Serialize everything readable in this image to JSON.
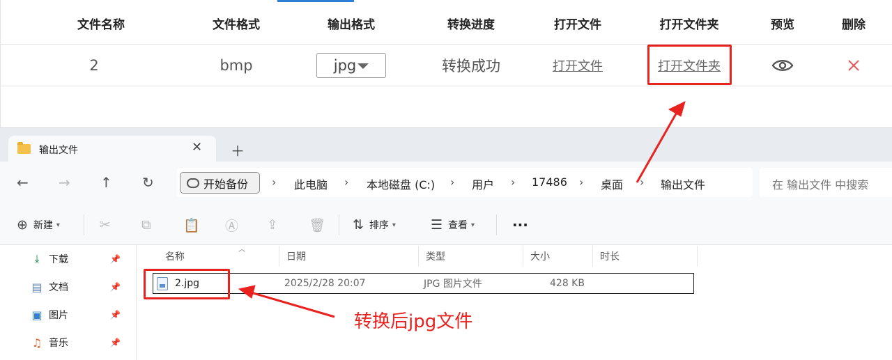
{
  "converter": {
    "headers": [
      "文件名称",
      "文件格式",
      "输出格式",
      "转换进度",
      "打开文件",
      "打开文件夹",
      "预览",
      "删除"
    ],
    "row": {
      "name": "2",
      "format": "bmp",
      "output_format": "jpg",
      "status": "转换成功",
      "open_file": "打开文件",
      "open_folder": "打开文件夹"
    }
  },
  "annotation": {
    "label": "转换后jpg文件",
    "color": "#e8221f"
  },
  "explorer": {
    "tab_title": "输出文件",
    "backup_label": "开始备份",
    "breadcrumbs": [
      "此电脑",
      "本地磁盘 (C:)",
      "用户",
      "17486",
      "桌面",
      "输出文件"
    ],
    "search_placeholder": "在 输出文件 中搜索",
    "commands": {
      "new": "新建",
      "sort": "排序",
      "view": "查看"
    },
    "sidebar": [
      {
        "label": "下载",
        "icon": "download-icon"
      },
      {
        "label": "文档",
        "icon": "document-icon"
      },
      {
        "label": "图片",
        "icon": "picture-icon"
      },
      {
        "label": "音乐",
        "icon": "music-icon"
      }
    ],
    "columns": [
      "名称",
      "日期",
      "类型",
      "大小",
      "时长"
    ],
    "files": [
      {
        "name": "2.jpg",
        "date": "2025/2/28 20:07",
        "type": "JPG 图片文件",
        "size": "428 KB",
        "duration": ""
      }
    ]
  }
}
